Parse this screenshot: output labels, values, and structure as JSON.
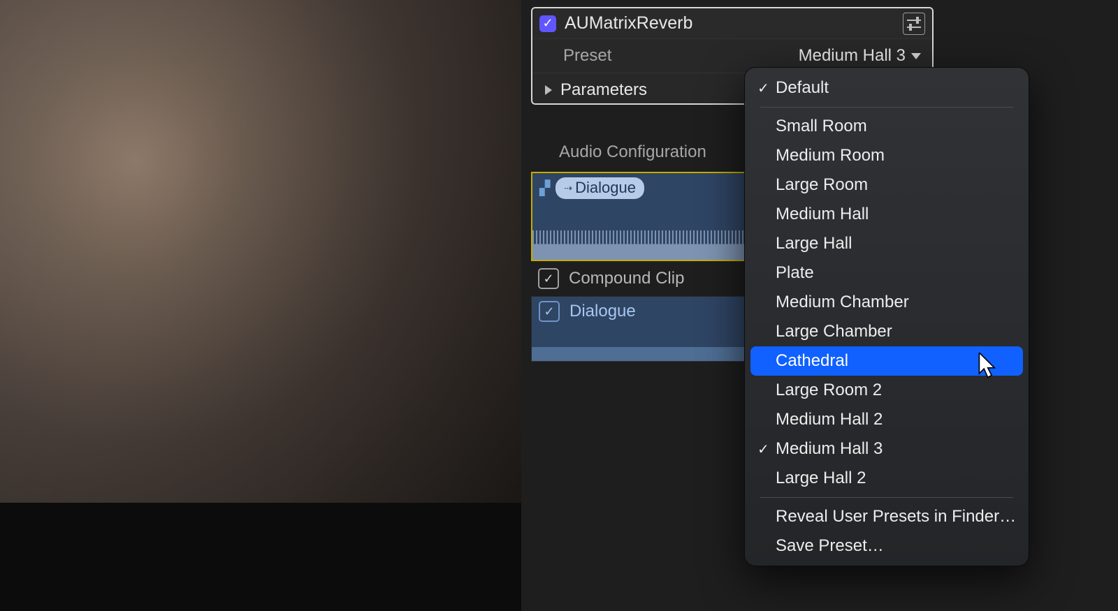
{
  "effect": {
    "title": "AUMatrixReverb",
    "preset_label": "Preset",
    "preset_value": "Medium Hall 3",
    "params_label": "Parameters"
  },
  "audio_config": {
    "title": "Audio Configuration",
    "role_chip": "Dialogue",
    "compound_label": "Compound Clip",
    "sub_label": "Dialogue"
  },
  "dropdown": {
    "default": "Default",
    "items": [
      "Small Room",
      "Medium Room",
      "Large Room",
      "Medium Hall",
      "Large Hall",
      "Plate",
      "Medium Chamber",
      "Large Chamber",
      "Cathedral",
      "Large Room 2",
      "Medium Hall 2",
      "Medium Hall 3",
      "Large Hall 2"
    ],
    "highlighted": "Cathedral",
    "checked": "Medium Hall 3",
    "footer": {
      "reveal": "Reveal User Presets in Finder…",
      "save": "Save Preset…"
    }
  }
}
